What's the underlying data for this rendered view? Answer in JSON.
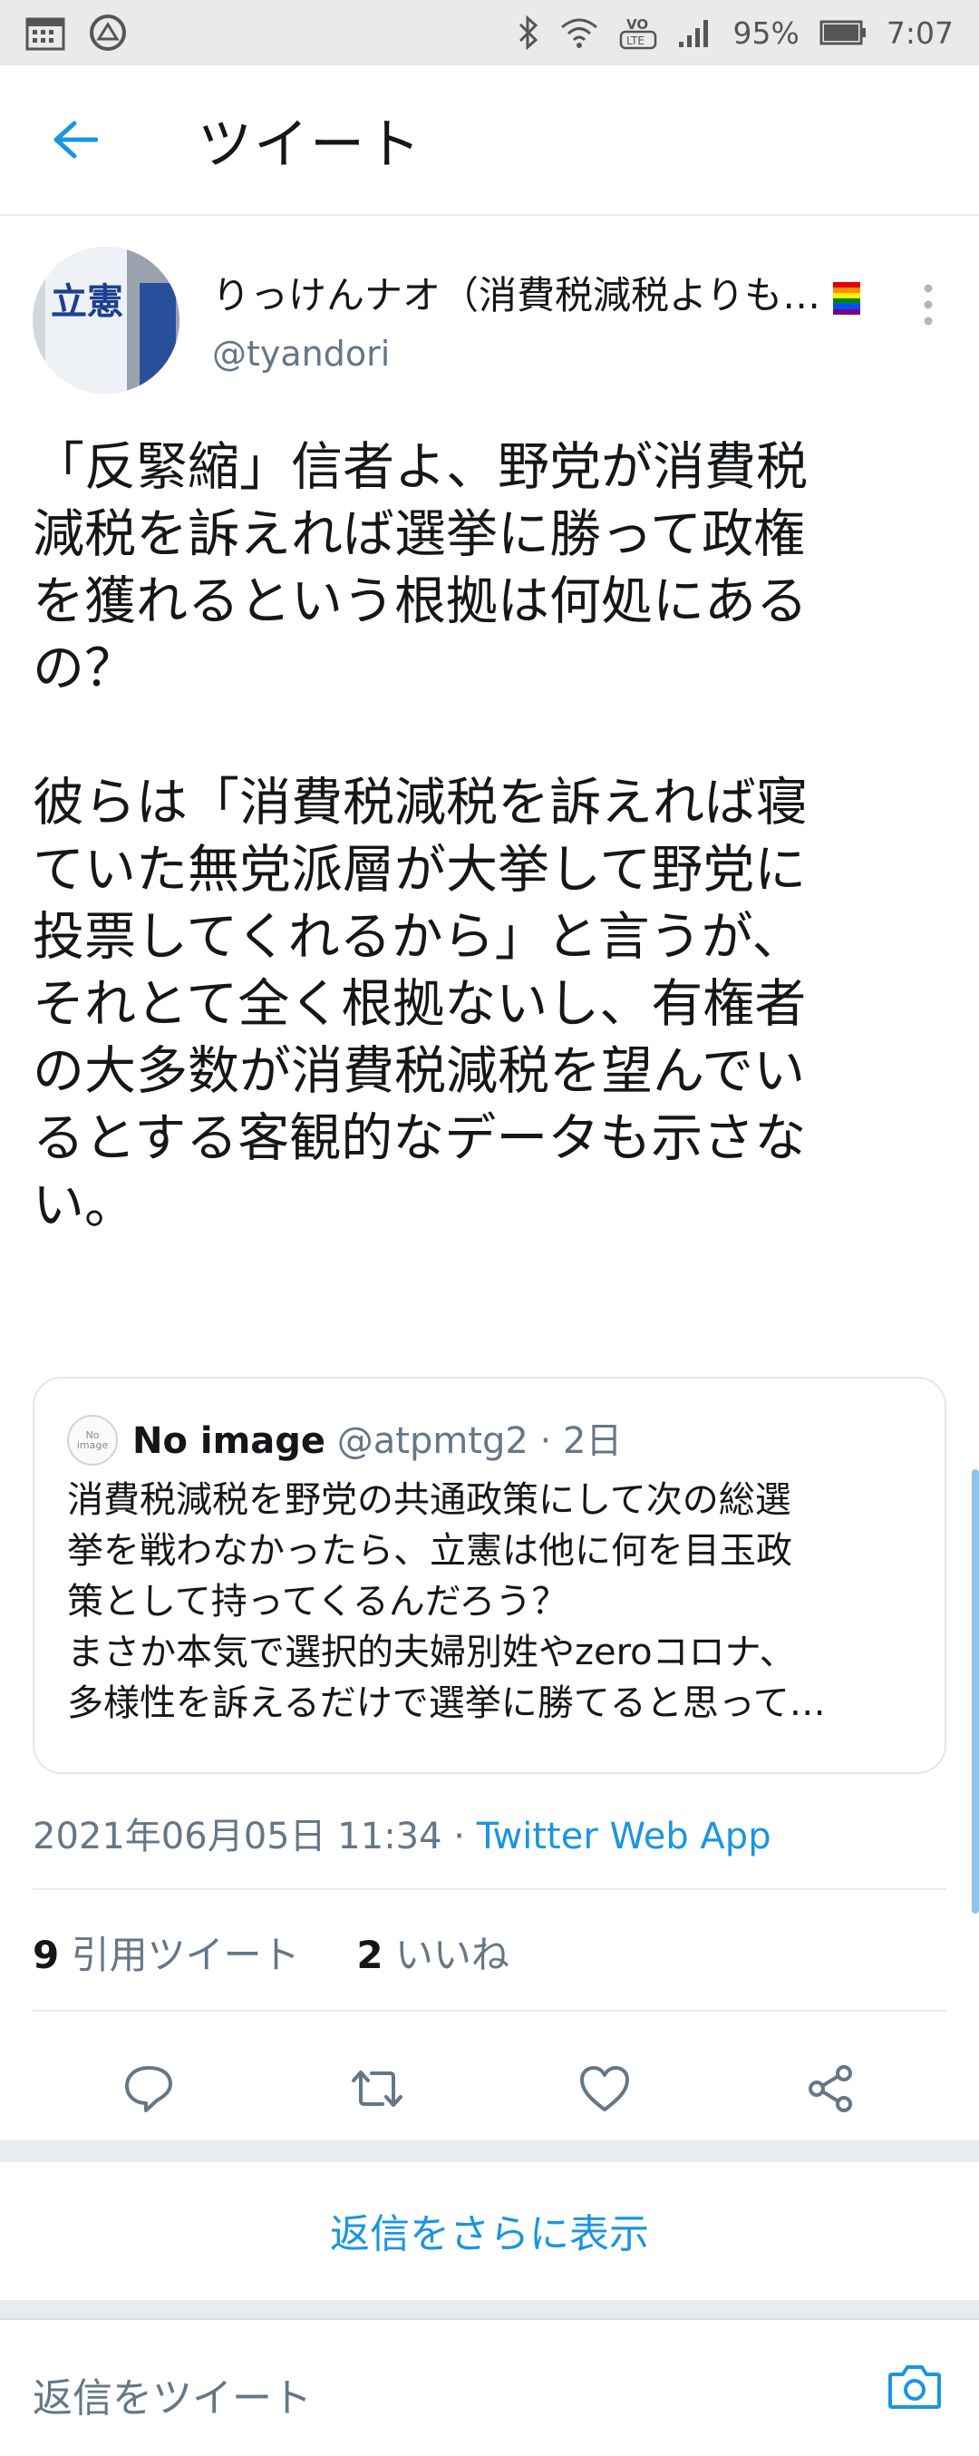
{
  "status_bar": {
    "battery": "95%",
    "time": "7:07",
    "volte": "VO LTE"
  },
  "header": {
    "title": "ツイート"
  },
  "author": {
    "name": "りっけんナオ（消費税減税よりも…",
    "handle": "@tyandori",
    "avatar_text": "立憲"
  },
  "tweet": {
    "paragraph1": "「反緊縮」信者よ、野党が消費税\n減税を訴えれば選挙に勝って政権\nを獲れるという根拠は何処にある\nの？",
    "paragraph2": "彼らは「消費税減税を訴えれば寝\nていた無党派層が大挙して野党に\n投票してくれるから」と言うが、\nそれとて全く根拠ないし、有権者\nの大多数が消費税減税を望んでい\nるとする客観的なデータも示さな\nい。"
  },
  "quote": {
    "avatar_text": "No image",
    "name": "No image",
    "meta": " @atpmtg2 · 2日",
    "lines": [
      "消費税減税を野党の共通政策にして次の総選",
      "挙を戦わなかったら、立憲は他に何を目玉政",
      "策として持ってくるんだろう？",
      "まさか本気で選択的夫婦別姓やzeroコロナ、",
      "多様性を訴えるだけで選挙に勝てると思って…"
    ]
  },
  "timestamp": {
    "date": "2021年06月05日 11:34 · ",
    "via": "Twitter Web App"
  },
  "stats": {
    "quotes_count": "9",
    "quotes_label": " 引用ツイート",
    "likes_count": "2",
    "likes_label": " いいね"
  },
  "more_replies": "返信をさらに表示",
  "reply_placeholder": "返信をツイート",
  "colors": {
    "accent": "#1b95e0",
    "text": "#14171a",
    "muted": "#657786"
  }
}
